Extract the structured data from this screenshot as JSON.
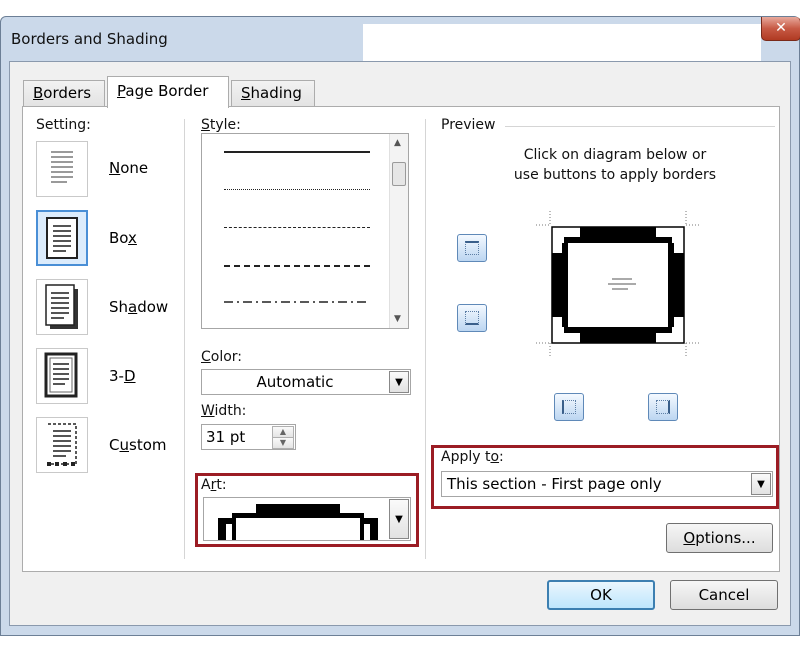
{
  "window": {
    "title": "Borders and Shading",
    "close_glyph": "✕"
  },
  "tabs": [
    {
      "label_pre": "",
      "key": "B",
      "label_post": "orders"
    },
    {
      "label_pre": "",
      "key": "P",
      "label_post": "age Border"
    },
    {
      "label_pre": "",
      "key": "S",
      "label_post": "hading"
    }
  ],
  "setting": {
    "label": "Setting:",
    "items": [
      {
        "pre": "",
        "key": "N",
        "post": "one"
      },
      {
        "pre": "Bo",
        "key": "x",
        "post": ""
      },
      {
        "pre": "Sh",
        "key": "a",
        "post": "dow"
      },
      {
        "pre": "3-",
        "key": "D",
        "post": ""
      },
      {
        "pre": "C",
        "key": "u",
        "post": "stom"
      }
    ],
    "selected": "Box"
  },
  "style": {
    "label_key": "S",
    "label_post": "tyle:"
  },
  "color": {
    "label_key": "C",
    "label_post": "olor:",
    "value": "Automatic"
  },
  "width": {
    "label_key": "W",
    "label_post": "idth:",
    "value": "31 pt"
  },
  "art": {
    "label_pre": "A",
    "label_key": "r",
    "label_post": "t:"
  },
  "preview": {
    "label": "Preview",
    "instruction_line1": "Click on diagram below or",
    "instruction_line2": "use buttons to apply borders"
  },
  "apply_to": {
    "label_pre": "Apply t",
    "label_key": "o",
    "label_post": ":",
    "value": "This section - First page only"
  },
  "buttons": {
    "options_key": "O",
    "options_post": "ptions...",
    "ok": "OK",
    "cancel": "Cancel"
  },
  "colors": {
    "highlight": "#9b1c24",
    "selection": "#4a8fd6"
  },
  "icons": {
    "dropdown": "▼",
    "scroll_up": "▲",
    "scroll_down": "▼",
    "spin_up": "▲",
    "spin_down": "▼"
  }
}
